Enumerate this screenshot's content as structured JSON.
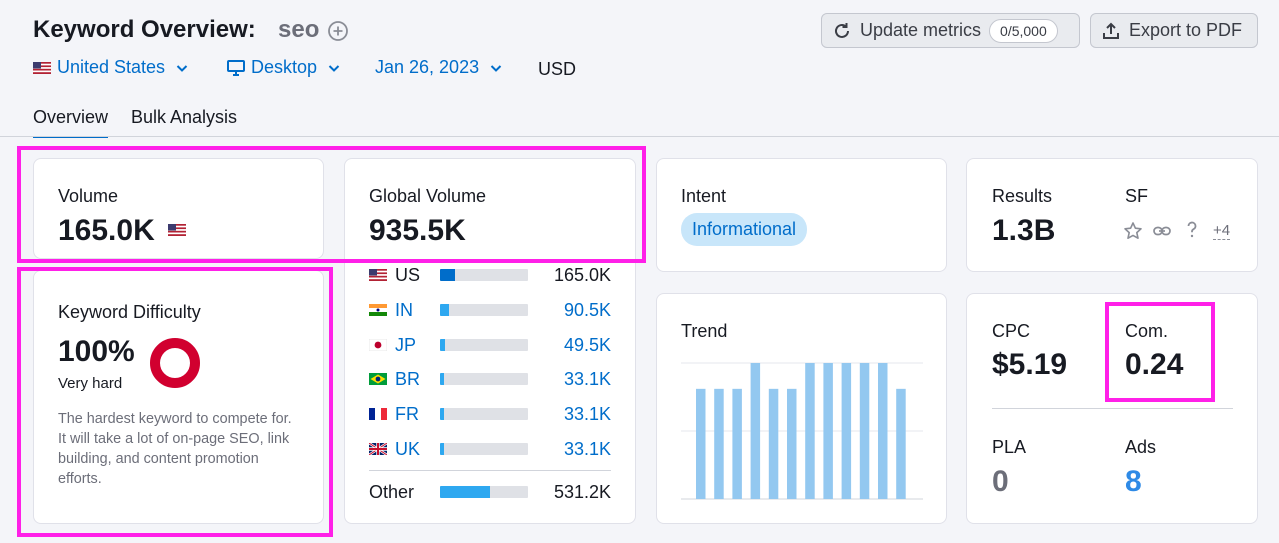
{
  "header": {
    "title": "Keyword Overview:",
    "keyword": "seo",
    "filters": {
      "country": "United States",
      "device": "Desktop",
      "date": "Jan 26, 2023",
      "currency": "USD"
    },
    "update_button": {
      "label": "Update metrics",
      "counter": "0/5,000"
    },
    "export_button": {
      "label": "Export to PDF"
    }
  },
  "tabs": [
    {
      "label": "Overview",
      "active": true
    },
    {
      "label": "Bulk Analysis",
      "active": false
    }
  ],
  "volume": {
    "label": "Volume",
    "value": "165.0K"
  },
  "global_volume": {
    "label": "Global Volume",
    "value": "935.5K",
    "countries": [
      {
        "code": "US",
        "value": "165.0K",
        "share": 0.176
      },
      {
        "code": "IN",
        "value": "90.5K",
        "share": 0.097
      },
      {
        "code": "JP",
        "value": "49.5K",
        "share": 0.053
      },
      {
        "code": "BR",
        "value": "33.1K",
        "share": 0.035
      },
      {
        "code": "FR",
        "value": "33.1K",
        "share": 0.035
      },
      {
        "code": "UK",
        "value": "33.1K",
        "share": 0.035
      }
    ],
    "other": {
      "label": "Other",
      "value": "531.2K",
      "share": 0.568
    }
  },
  "difficulty": {
    "label": "Keyword Difficulty",
    "value": "100%",
    "level": "Very hard",
    "description": "The hardest keyword to compete for. It will take a lot of on-page SEO, link building, and content promotion efforts.",
    "percent": 100,
    "color": "#d1002f"
  },
  "intent": {
    "label": "Intent",
    "value": "Informational"
  },
  "results": {
    "label": "Results",
    "value": "1.3B"
  },
  "sf": {
    "label": "SF",
    "more": "+4",
    "icons": [
      "star-icon",
      "link-icon",
      "question-icon"
    ]
  },
  "trend": {
    "label": "Trend",
    "bars": [
      0.81,
      0.81,
      0.81,
      1.0,
      0.81,
      0.81,
      1.0,
      1.0,
      1.0,
      1.0,
      1.0,
      0.81
    ]
  },
  "cpc": {
    "label": "CPC",
    "value": "$5.19"
  },
  "com": {
    "label": "Com.",
    "value": "0.24"
  },
  "pla": {
    "label": "PLA",
    "value": "0"
  },
  "ads": {
    "label": "Ads",
    "value": "8"
  },
  "colors": {
    "accent": "#006dca",
    "highlight": "#ff20e8",
    "bar": "#2ea8f0",
    "trend_bar": "#93c8f0"
  }
}
